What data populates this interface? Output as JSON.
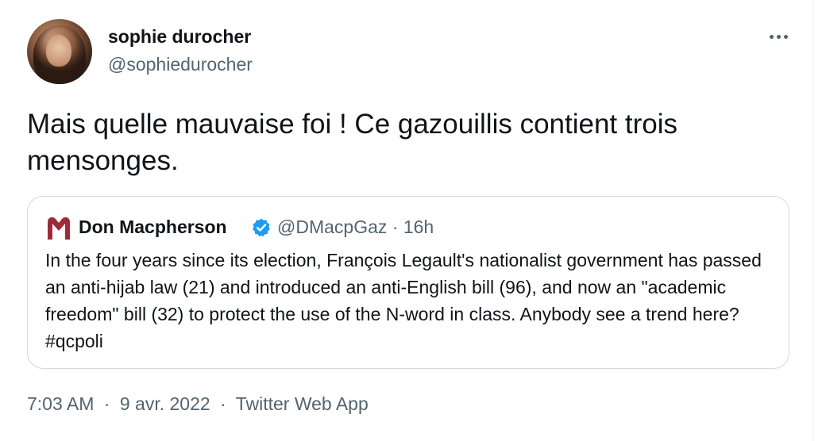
{
  "author": {
    "display_name": "sophie durocher",
    "handle": "@sophiedurocher"
  },
  "tweet": {
    "text": "Mais quelle mauvaise foi ! Ce gazouillis contient trois mensonges."
  },
  "quoted_tweet": {
    "display_name": "Don Macpherson",
    "handle": "@DMacpGaz",
    "separator": "·",
    "time_ago": "16h",
    "text": "In the four years since its election, François Legault's nationalist government has passed an anti-hijab law (21) and introduced an anti-English bill (96), and now an \"academic freedom\" bill (32) to protect the use of the N-word in class. Anybody see a trend here? #qcpoli",
    "logo_color": "#9e2b38",
    "verified_color": "#1d9bf0"
  },
  "footer": {
    "time": "7:03 AM",
    "separator": "·",
    "date": "9 avr. 2022",
    "source": "Twitter Web App"
  },
  "icons": {
    "more": "more-dots-icon",
    "verified": "verified-badge-icon",
    "logo": "gazette-logo-icon"
  }
}
